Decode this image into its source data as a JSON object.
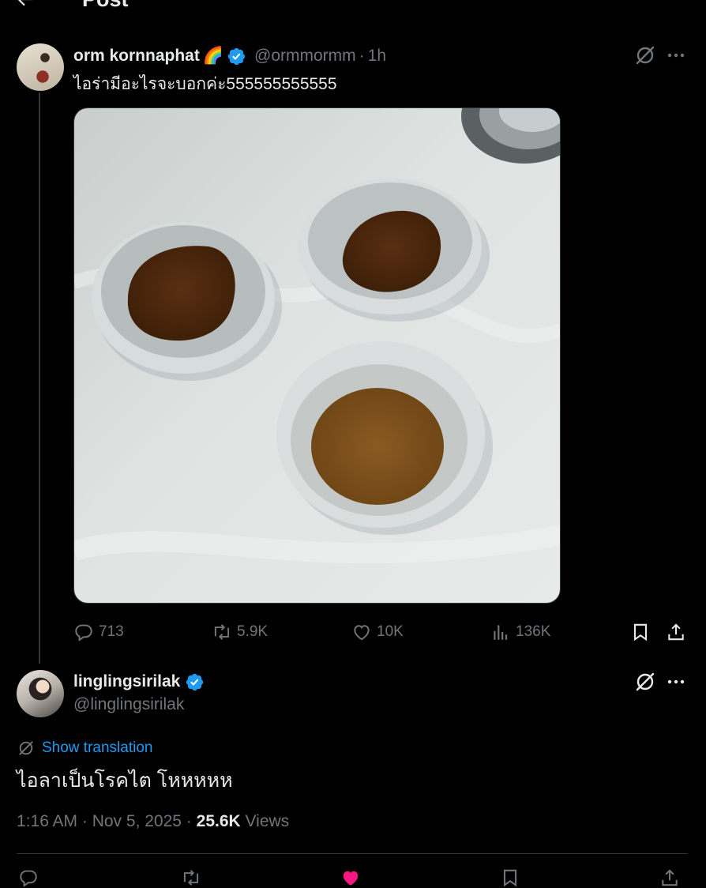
{
  "header": {
    "title": "Post",
    "back_icon": "back-arrow-icon"
  },
  "post": {
    "author": {
      "display_name": "orm kornnaphat",
      "emoji": "🌈",
      "handle": "@ormmormm",
      "time": "1h"
    },
    "text": "ไอร่ามีอะไรจะบอกค่ะ555555555555",
    "stats": {
      "replies": "713",
      "reposts": "5.9K",
      "likes": "10K",
      "views": "136K"
    }
  },
  "reply": {
    "author": {
      "display_name": "linglingsirilak",
      "handle": "@linglingsirilak"
    },
    "translate_label": "Show translation",
    "text": "ไอลาเป็นโรคไต โหหหหห",
    "timestamp": "1:16 AM · Nov 5, 2025",
    "separator": " · ",
    "views_count": "25.6K",
    "views_label": "Views"
  },
  "colors": {
    "accent": "#1d9bf0",
    "muted": "#71767b",
    "text": "#e7e9ea",
    "like_active": "#f91880",
    "background": "#000000"
  }
}
